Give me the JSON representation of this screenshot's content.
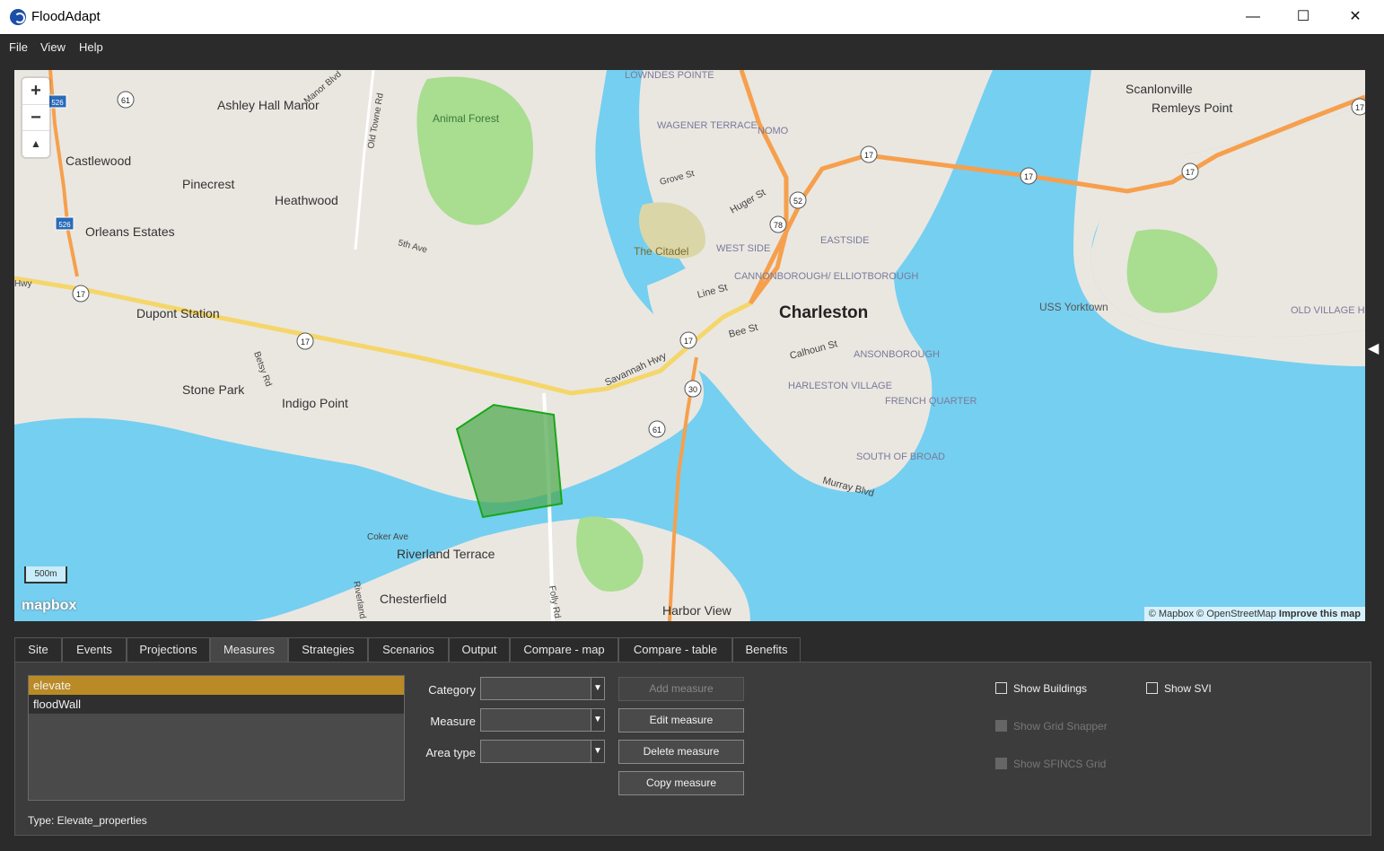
{
  "window": {
    "title": "FloodAdapt",
    "minimize": "—",
    "maximize": "☐",
    "close": "✕"
  },
  "menu": [
    "File",
    "View",
    "Help"
  ],
  "map": {
    "zoom_in": "+",
    "zoom_out": "−",
    "compass": "▲",
    "scale": "500m",
    "logo": "mapbox",
    "attribution": "© Mapbox © OpenStreetMap",
    "improve": "Improve this map",
    "labels": {
      "charleston": "Charleston",
      "ashley_hall_manor": "Ashley Hall Manor",
      "castlewood": "Castlewood",
      "pinecrest": "Pinecrest",
      "heathwood": "Heathwood",
      "orleans_estates": "Orleans Estates",
      "dupont_station": "Dupont Station",
      "stone_park": "Stone Park",
      "indigo_point": "Indigo Point",
      "riverland_terrace": "Riverland Terrace",
      "chesterfield": "Chesterfield",
      "harbor_view": "Harbor View",
      "animal_forest": "Animal Forest",
      "the_citadel": "The Citadel",
      "uss_yorktown": "USS Yorktown",
      "scanlonville": "Scanlonville",
      "remleys_point": "Remleys Point",
      "lowndes_pointe": "LOWNDES POINTE",
      "wagener_terrace": "WAGENER TERRACE",
      "nomo": "NOMO",
      "eastside": "EASTSIDE",
      "west_side": "WEST SIDE",
      "cannonborough": "CANNONBOROUGH/ ELLIOTBOROUGH",
      "ansonborough": "ANSONBOROUGH",
      "harleston_village": "HARLESTON VILLAGE",
      "french_quarter": "FRENCH QUARTER",
      "south_of_broad": "SOUTH OF BROAD",
      "old_village": "OLD VILLAGE HISTORIC DISTRICT",
      "savannah_hwy": "Savannah Hwy",
      "murray_blvd": "Murray Blvd",
      "calhoun_st": "Calhoun St",
      "bee_st": "Bee St",
      "line_st": "Line St",
      "huger_st": "Huger St",
      "grove_st": "Grove St",
      "fifth_ave": "5th Ave",
      "manor_blvd": "Manor Blvd",
      "old_towne_rd": "Old Towne Rd",
      "betsy_rd": "Betsy Rd",
      "coker_ave": "Coker Ave",
      "folly_rd": "Folly Rd",
      "riverland_dr": "Riverland Dr",
      "hwy": "Hwy",
      "r17": "17",
      "r61": "61",
      "r30": "30",
      "r52": "52",
      "r78": "78",
      "r526": "526"
    }
  },
  "tabs": [
    "Site",
    "Events",
    "Projections",
    "Measures",
    "Strategies",
    "Scenarios",
    "Output",
    "Compare - map",
    "Compare - table",
    "Benefits"
  ],
  "active_tab": "Measures",
  "measures": {
    "items": [
      "elevate",
      "floodWall"
    ],
    "selected": "elevate",
    "type_text": "Type: Elevate_properties",
    "category_label": "Category",
    "measure_label": "Measure",
    "area_type_label": "Area type",
    "add_button": "Add measure",
    "edit_button": "Edit measure",
    "delete_button": "Delete measure",
    "copy_button": "Copy measure"
  },
  "options": {
    "show_buildings": "Show Buildings",
    "show_svi": "Show SVI",
    "show_grid_snapper": "Show Grid Snapper",
    "show_sfincs_grid": "Show SFINCS Grid"
  },
  "colors": {
    "water": "#75cff0",
    "land": "#eae7e1",
    "park": "#a9dd90",
    "highway": "#f6a04d",
    "primary_road": "#f5d66a",
    "selection": "#b98a25",
    "polygon": "#4aa64a"
  }
}
